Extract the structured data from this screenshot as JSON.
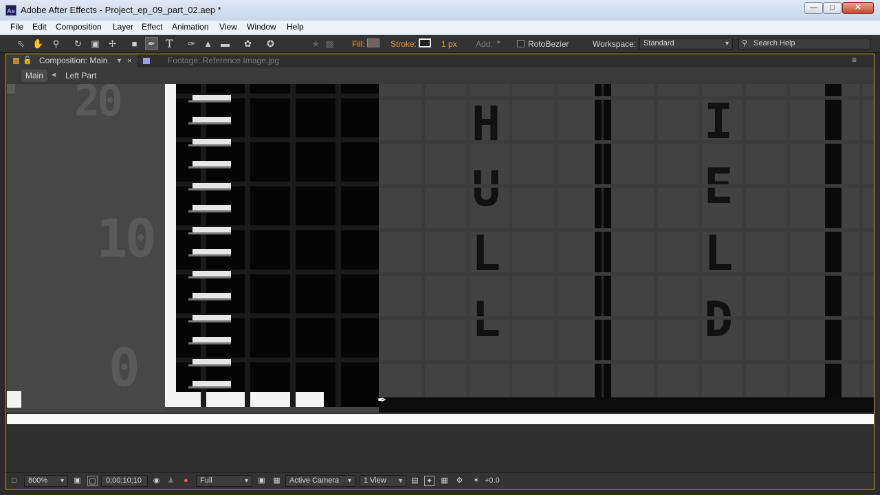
{
  "window": {
    "title": "Adobe After Effects - Project_ep_09_part_02.aep *",
    "app_icon_text": "Ae",
    "controls": [
      "minimize",
      "maximize",
      "close"
    ]
  },
  "menu": [
    "File",
    "Edit",
    "Composition",
    "Layer",
    "Effect",
    "Animation",
    "View",
    "Window",
    "Help"
  ],
  "toolbar": {
    "tools": [
      "selection-tool",
      "hand-tool",
      "zoom-tool",
      "rotation-tool",
      "camera-tool",
      "pan-behind-tool",
      "rectangle-tool",
      "pen-tool",
      "type-tool",
      "brush-tool",
      "clone-stamp-tool",
      "eraser-tool",
      "roto-brush-tool",
      "puppet-pin-tool"
    ],
    "active_tool": "pen-tool",
    "fill_label": "Fill:",
    "stroke_label": "Stroke:",
    "stroke_width": "1 px",
    "add_label": "Add:",
    "rotobezier_label": "RotoBezier",
    "rotobezier_checked": false,
    "workspace_label": "Workspace:",
    "workspace_value": "Standard",
    "search_placeholder": "Search Help",
    "accent_color": "#e8a13a"
  },
  "panel": {
    "active_tab": "Composition: Main",
    "inactive_tab": "Footage: Reference Image.jpg",
    "breadcrumbs": [
      "Main",
      "Left Part"
    ]
  },
  "canvas": {
    "left_labels": [
      "20",
      "10",
      "0"
    ],
    "column_letters_1": [
      "H",
      "U",
      "L",
      "L"
    ],
    "column_letters_2": [
      "I",
      "E",
      "L",
      "D"
    ]
  },
  "viewer_bar": {
    "magnification": "800%",
    "timecode": "0;00;10;10",
    "resolution": "Full",
    "camera": "Active Camera",
    "views": "1 View",
    "exposure": "+0.0"
  }
}
